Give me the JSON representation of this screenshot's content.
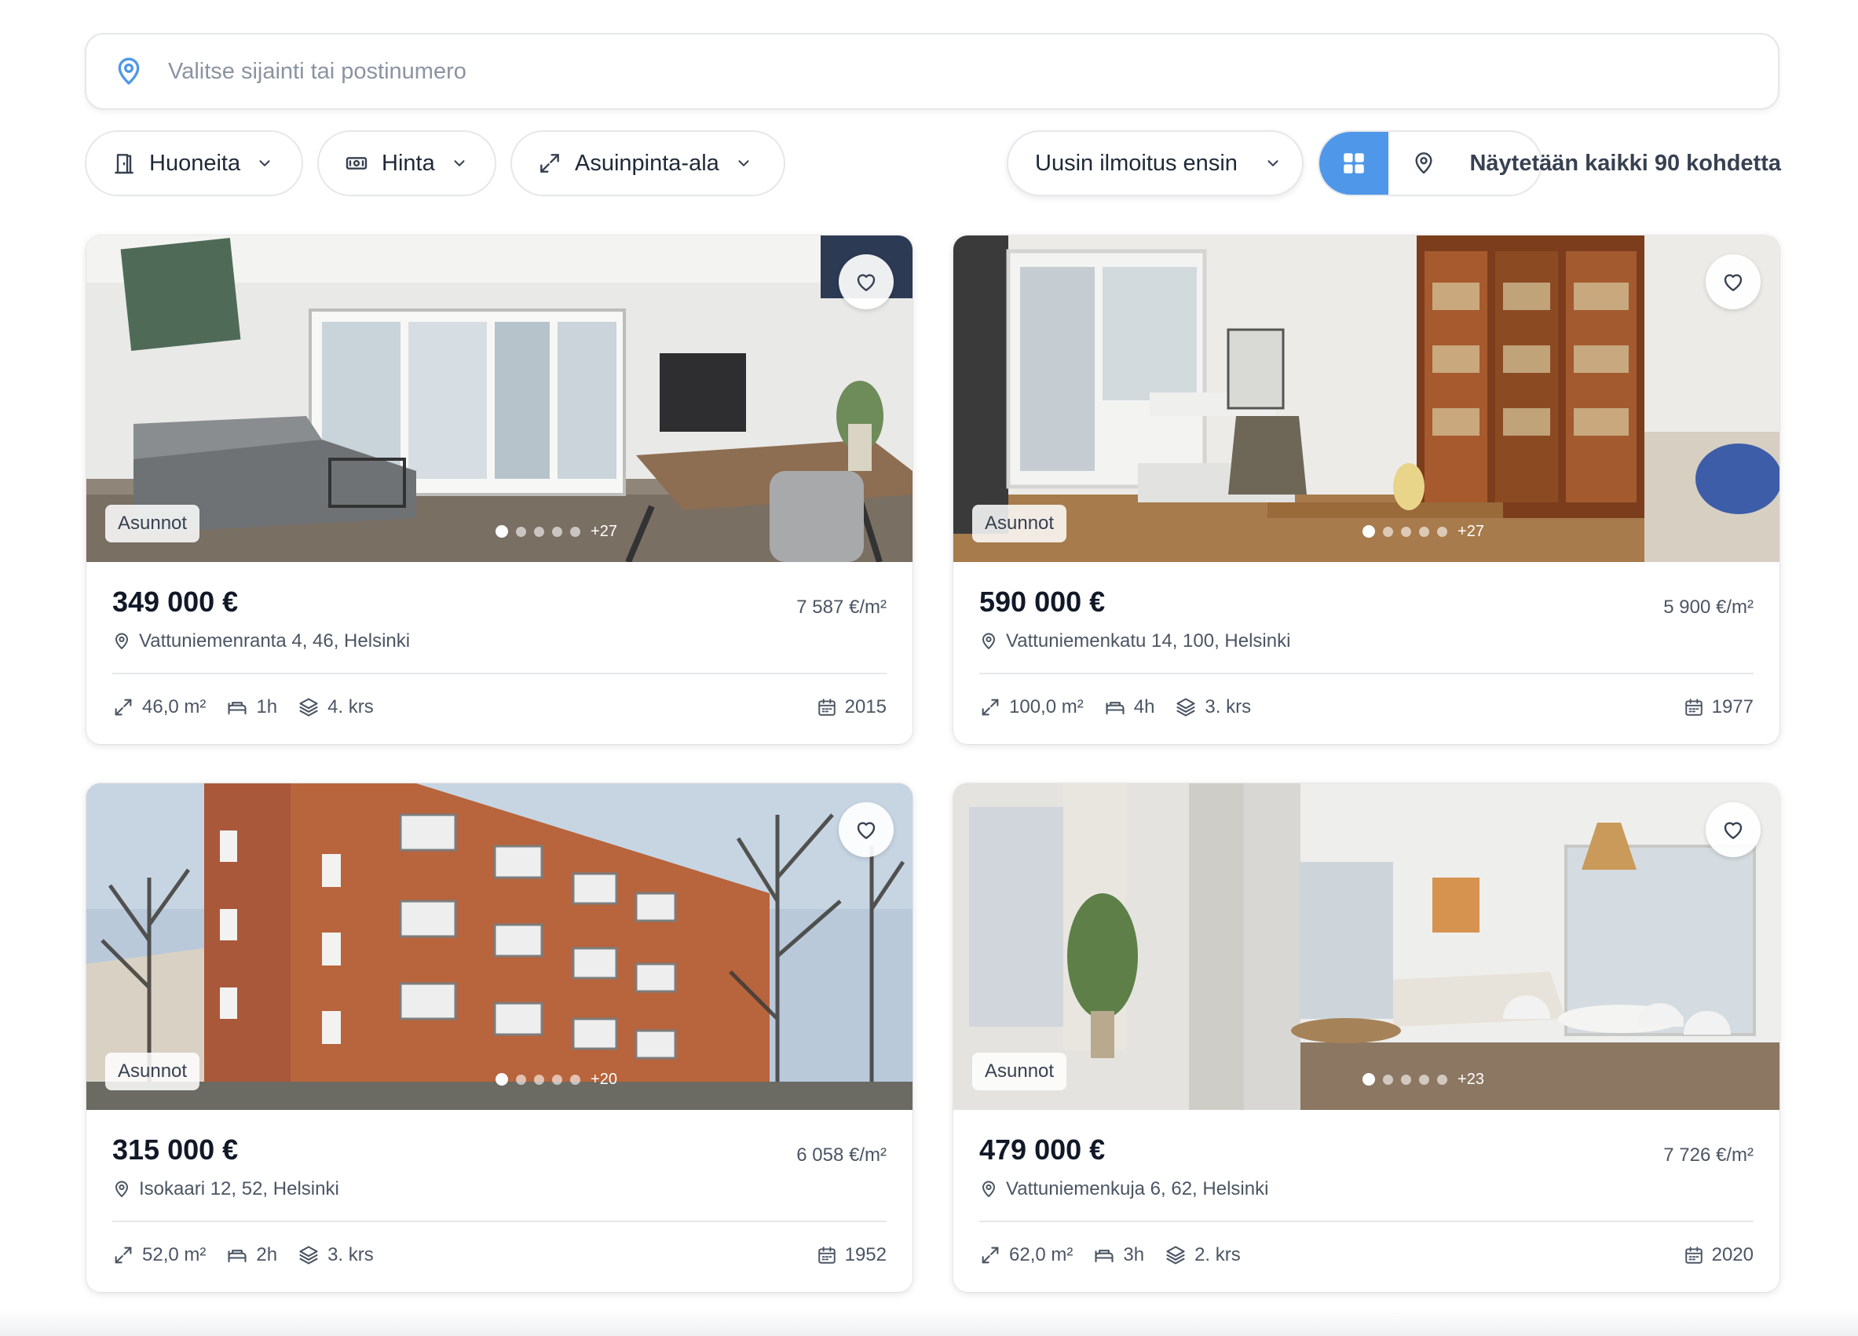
{
  "search": {
    "placeholder": "Valitse sijainti tai postinumero",
    "icon": "location-pin-icon"
  },
  "filters": [
    {
      "label": "Huoneita",
      "icon": "door-icon"
    },
    {
      "label": "Hinta",
      "icon": "banknote-icon"
    },
    {
      "label": "Asuinpinta-ala",
      "icon": "expand-arrows-icon"
    }
  ],
  "sort": {
    "selected": "Uusin ilmoitus ensin"
  },
  "view": {
    "active": "grid",
    "accent": "#4f97e8"
  },
  "results": {
    "count_text": "Näytetään kaikki 90 kohdetta"
  },
  "listings": [
    {
      "type": "Asunnot",
      "more_photos": "+27",
      "price": "349 000 €",
      "price_per_m2": "7 587 €/m²",
      "address": "Vattuniemenranta 4, 46, Helsinki",
      "area": "46,0 m²",
      "rooms": "1h",
      "floor": "4. krs",
      "year": "2015"
    },
    {
      "type": "Asunnot",
      "more_photos": "+27",
      "price": "590 000 €",
      "price_per_m2": "5 900 €/m²",
      "address": "Vattuniemenkatu 14, 100, Helsinki",
      "area": "100,0 m²",
      "rooms": "4h",
      "floor": "3. krs",
      "year": "1977"
    },
    {
      "type": "Asunnot",
      "more_photos": "+20",
      "price": "315 000 €",
      "price_per_m2": "6 058 €/m²",
      "address": "Isokaari 12, 52, Helsinki",
      "area": "52,0 m²",
      "rooms": "2h",
      "floor": "3. krs",
      "year": "1952"
    },
    {
      "type": "Asunnot",
      "more_photos": "+23",
      "price": "479 000 €",
      "price_per_m2": "7 726 €/m²",
      "address": "Vattuniemenkuja 6, 62, Helsinki",
      "area": "62,0 m²",
      "rooms": "3h",
      "floor": "2. krs",
      "year": "2020"
    }
  ]
}
